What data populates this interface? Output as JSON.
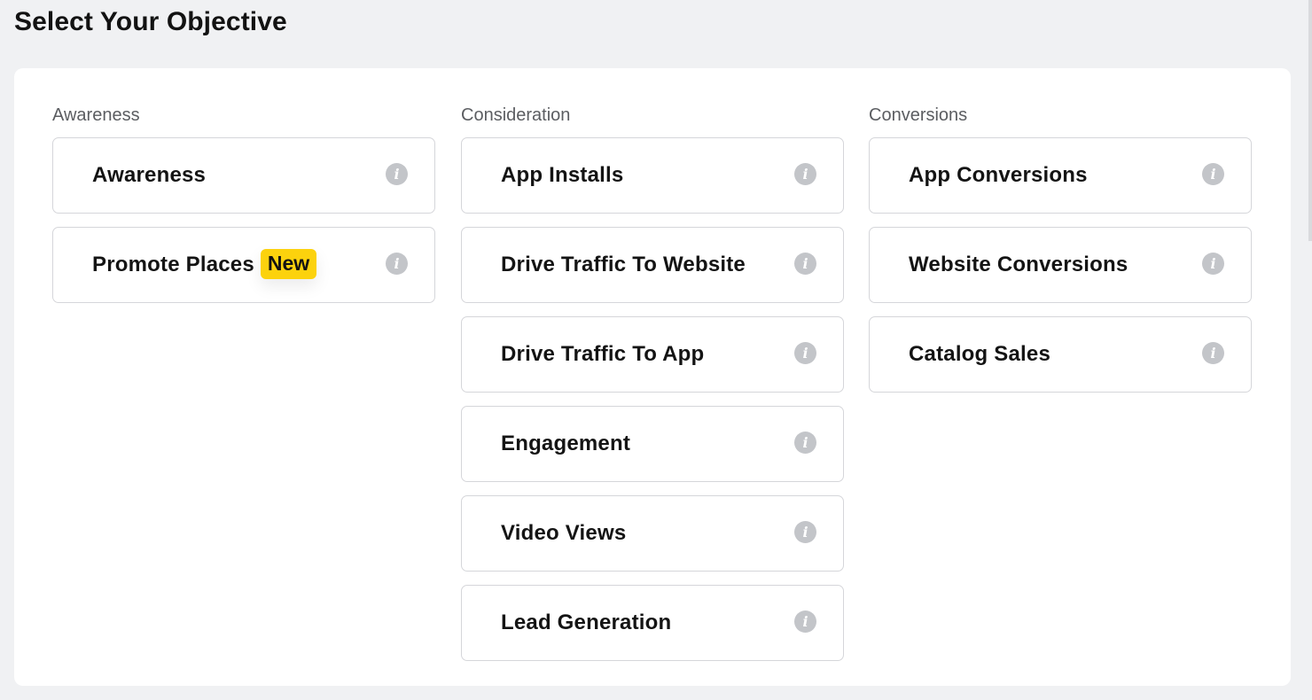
{
  "page": {
    "title": "Select Your Objective"
  },
  "columns": [
    {
      "heading": "Awareness",
      "items": [
        {
          "label": "Awareness",
          "badge": ""
        },
        {
          "label": "Promote Places",
          "badge": "New"
        }
      ]
    },
    {
      "heading": "Consideration",
      "items": [
        {
          "label": "App Installs",
          "badge": ""
        },
        {
          "label": "Drive Traffic To Website",
          "badge": ""
        },
        {
          "label": "Drive Traffic To App",
          "badge": ""
        },
        {
          "label": "Engagement",
          "badge": ""
        },
        {
          "label": "Video Views",
          "badge": ""
        },
        {
          "label": "Lead Generation",
          "badge": ""
        }
      ]
    },
    {
      "heading": "Conversions",
      "items": [
        {
          "label": "App Conversions",
          "badge": ""
        },
        {
          "label": "Website Conversions",
          "badge": ""
        },
        {
          "label": "Catalog Sales",
          "badge": ""
        }
      ]
    }
  ],
  "icons": {
    "info": "info-icon",
    "info_glyph": "i"
  },
  "colors": {
    "badge_bg": "#fcd20d",
    "info_icon_bg": "#c3c5c9",
    "page_bg": "#f0f1f3",
    "card_border": "#d5d6da"
  }
}
